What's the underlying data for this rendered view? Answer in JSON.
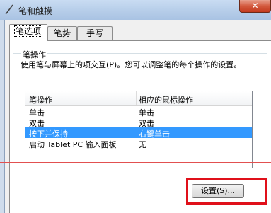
{
  "window": {
    "title": "笔和触摸",
    "close_symbol": "✕"
  },
  "tabs": [
    {
      "label": "笔选项",
      "active": true
    },
    {
      "label": "笔势",
      "active": false
    },
    {
      "label": "手写",
      "active": false
    }
  ],
  "group": {
    "label": "笔操作",
    "description": "使用笔与屏幕上的项交互(P)。您可以调整笔的每个操作的设置。"
  },
  "table": {
    "headers": [
      "笔操作",
      "相应的鼠标操作"
    ],
    "rows": [
      {
        "action": "单击",
        "equivalent": "单击",
        "selected": false
      },
      {
        "action": "双击",
        "equivalent": "双击",
        "selected": false
      },
      {
        "action": "按下并保持",
        "equivalent": "右键单击",
        "selected": true
      },
      {
        "action": "启动 Tablet PC 输入面板",
        "equivalent": "无",
        "selected": false
      }
    ]
  },
  "buttons": {
    "settings_label": "设置(S)..."
  },
  "colors": {
    "selection": "#3399ff",
    "annotation_red": "#e0101a"
  }
}
